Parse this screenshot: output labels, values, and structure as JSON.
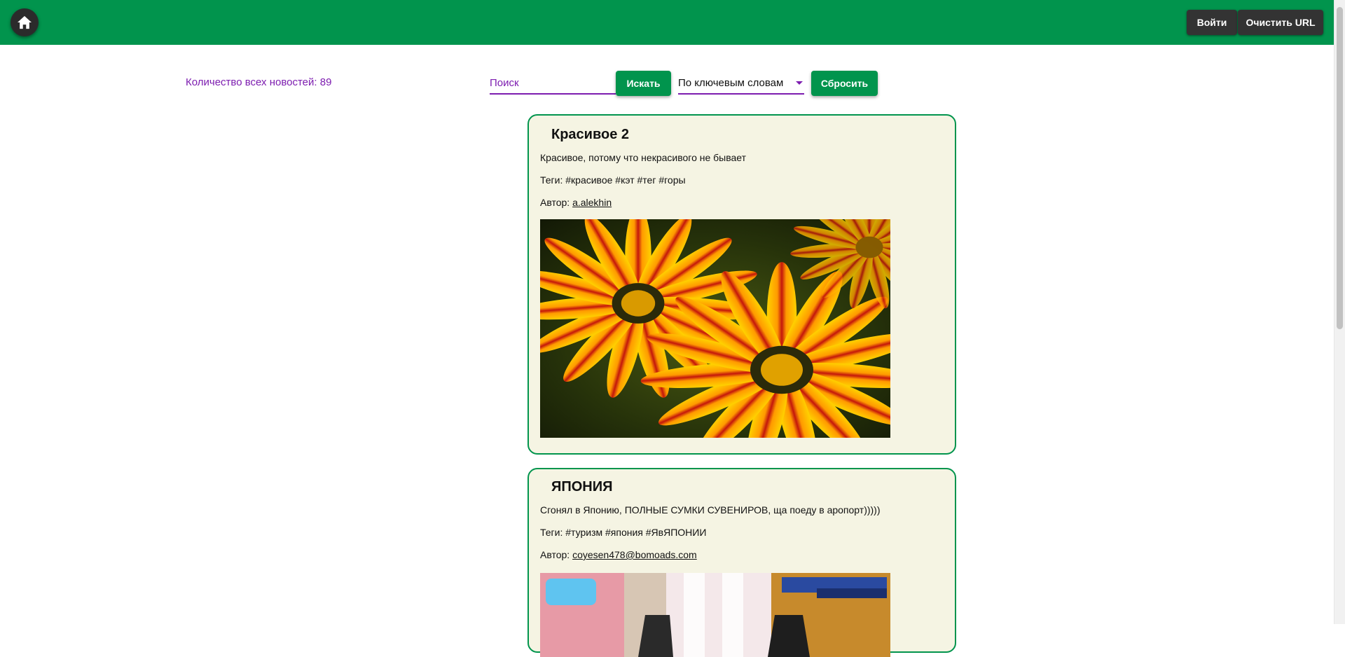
{
  "header": {
    "home_icon": "home-icon",
    "login_label": "Войти",
    "clear_url_label": "Очистить URL",
    "brand_color": "#01944d"
  },
  "toolbar": {
    "news_count_label": "Количество всех новостей: 89",
    "search_placeholder": "Поиск",
    "search_button": "Искать",
    "filter_selected": "По ключевым словам",
    "reset_button": "Сбросить"
  },
  "posts": [
    {
      "title": "Красивое 2",
      "text": "Красивое, потому что некрасивого не бывает",
      "tags": "Теги: #красивое #кэт #тег #горы",
      "author_prefix": "Автор: ",
      "author": "a.alekhin",
      "image": "orange-red striped gazania flowers"
    },
    {
      "title": "ЯПОНИЯ",
      "text": "Сгонял в Японию, ПОЛНЫЕ СУМКИ СУВЕНИРОВ, ща поеду в аропорт)))))",
      "tags": "Теги: #туризм #япония #ЯвЯПОНИИ",
      "author_prefix": "Автор: ",
      "author": "coyesen478@bomoads.com",
      "image": "japanese tv show scene with shopping bags"
    }
  ]
}
